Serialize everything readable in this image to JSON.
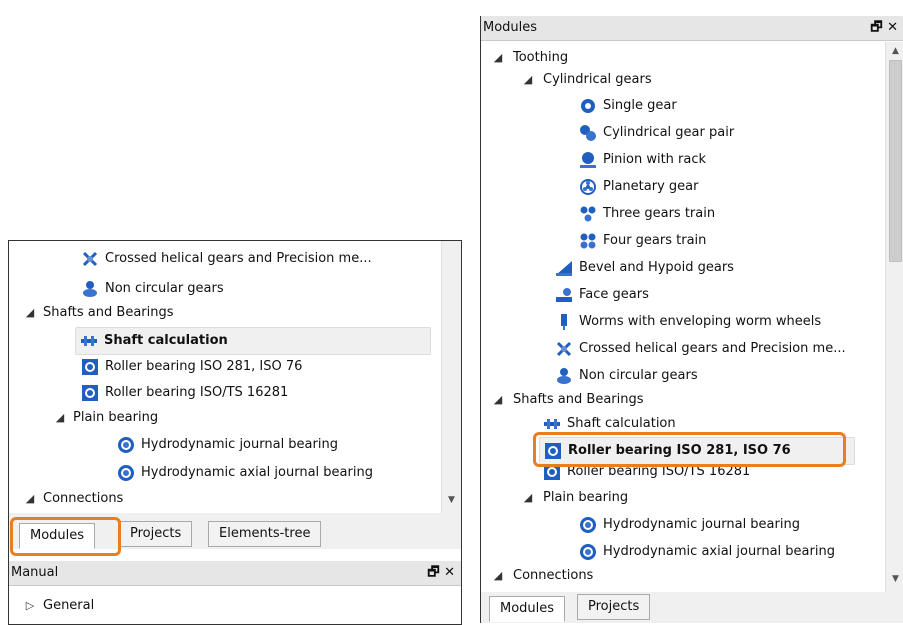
{
  "left": {
    "tree_items": [
      "Crossed helical gears and Precision me...",
      "Non circular gears",
      "Shafts and Bearings",
      "Shaft calculation",
      "Roller bearing ISO 281, ISO 76",
      "Roller bearing ISO/TS 16281",
      "Plain bearing",
      "Hydrodynamic journal bearing",
      "Hydrodynamic axial journal bearing",
      "Connections"
    ],
    "tabs": [
      "Modules",
      "Projects",
      "Elements-tree"
    ],
    "manual_title": "Manual",
    "manual_items": [
      "General"
    ],
    "window_buttons": "🗗 ✕"
  },
  "right": {
    "title": "Modules",
    "window_buttons": "🗗 ✕",
    "tree_items": [
      "Toothing",
      "Cylindrical gears",
      "Single gear",
      "Cylindrical gear pair",
      "Pinion with rack",
      "Planetary gear",
      "Three gears train",
      "Four gears train",
      "Bevel and Hypoid gears",
      "Face gears",
      "Worms with enveloping worm wheels",
      "Crossed helical gears and Precision me...",
      "Non circular gears",
      "Shafts and Bearings",
      "Shaft calculation",
      "Roller bearing ISO 281, ISO 76",
      "Roller bearing ISO/TS 16281",
      "Plain bearing",
      "Hydrodynamic journal bearing",
      "Hydrodynamic axial journal bearing",
      "Connections"
    ],
    "tabs": [
      "Modules",
      "Projects"
    ]
  },
  "colors": {
    "highlight": "#e67e22",
    "icon_blue": "#1f5fbf",
    "selection_bg": "#f0f0f0"
  },
  "icons": {
    "expanded": "triangle-down-icon",
    "collapsed": "triangle-right-icon",
    "gear": "gear-icon",
    "bearing": "bearing-icon",
    "shaft": "shaft-icon"
  }
}
